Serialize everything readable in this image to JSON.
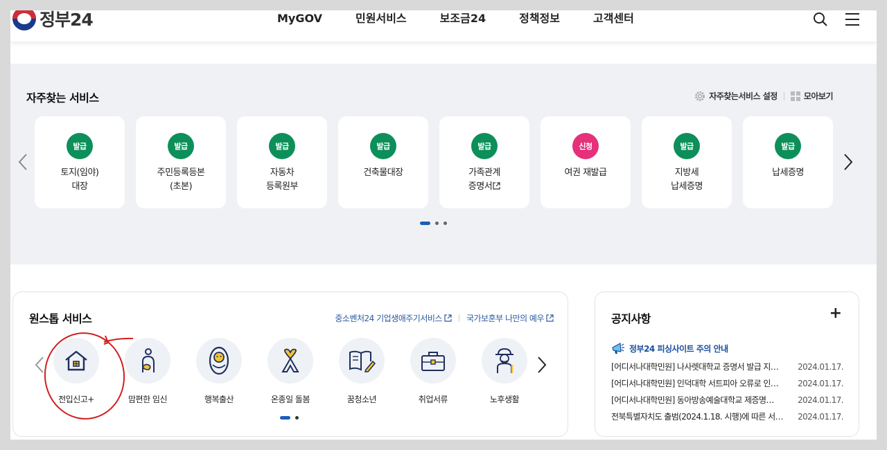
{
  "header": {
    "logo_text": "정부24",
    "nav": [
      "MyGOV",
      "민원서비스",
      "보조금24",
      "정책정보",
      "고객센터"
    ],
    "icons": [
      "search-icon",
      "menu-icon"
    ]
  },
  "favorites": {
    "title": "자주찾는 서비스",
    "settings_label": "자주찾는서비스 설정",
    "collect_label": "모아보기",
    "cards": [
      {
        "badge": "발급",
        "label": "토지(임야)\n대장",
        "badge_color": "#0d8f5a"
      },
      {
        "badge": "발급",
        "label": "주민등록등본\n(초본)",
        "badge_color": "#0d8f5a"
      },
      {
        "badge": "발급",
        "label": "자동차\n등록원부",
        "badge_color": "#0d8f5a"
      },
      {
        "badge": "발급",
        "label": "건축물대장",
        "badge_color": "#0d8f5a"
      },
      {
        "badge": "발급",
        "label": "가족관계\n증명서",
        "badge_color": "#0d8f5a",
        "external": true
      },
      {
        "badge": "신청",
        "label": "여권 재발급",
        "badge_color": "#e4317a"
      },
      {
        "badge": "발급",
        "label": "지방세\n납세증명",
        "badge_color": "#0d8f5a"
      },
      {
        "badge": "발급",
        "label": "납세증명",
        "badge_color": "#0d8f5a"
      }
    ]
  },
  "onestop": {
    "title": "원스톱 서비스",
    "link1": "중소벤처24 기업생애주기서비스",
    "link2": "국가보훈부 나만의 예우",
    "items": [
      {
        "label": "전입신고+",
        "icon": "house-icon"
      },
      {
        "label": "맘편한 임신",
        "icon": "pregnancy-icon"
      },
      {
        "label": "행복출산",
        "icon": "baby-icon"
      },
      {
        "label": "온종일 돌봄",
        "icon": "ribbon-icon"
      },
      {
        "label": "꿈청소년",
        "icon": "book-icon"
      },
      {
        "label": "취업서류",
        "icon": "briefcase-icon"
      },
      {
        "label": "노후생활",
        "icon": "elder-icon"
      }
    ]
  },
  "notice": {
    "title": "공지사항",
    "more": "+",
    "top_notice": "정부24 피싱사이트 주의 안내",
    "items": [
      {
        "title": "[어디서나대학민원] 나사렛대학교 증명서 발급 지…",
        "date": "2024.01.17."
      },
      {
        "title": "[어디서나대학민원] 인덕대학 서트피아 오류로 인…",
        "date": "2024.01.17."
      },
      {
        "title": "[어디서나대학민원] 동아방송예술대학교 제증명…",
        "date": "2024.01.17."
      },
      {
        "title": "전북특별자치도 출범(2024.1.18. 시행)에 따른 서…",
        "date": "2024.01.17."
      }
    ]
  },
  "colors": {
    "accent": "#1a5fb4",
    "issue_badge": "#0d8f5a",
    "apply_badge": "#e4317a",
    "annotation": "#d21e1e"
  }
}
